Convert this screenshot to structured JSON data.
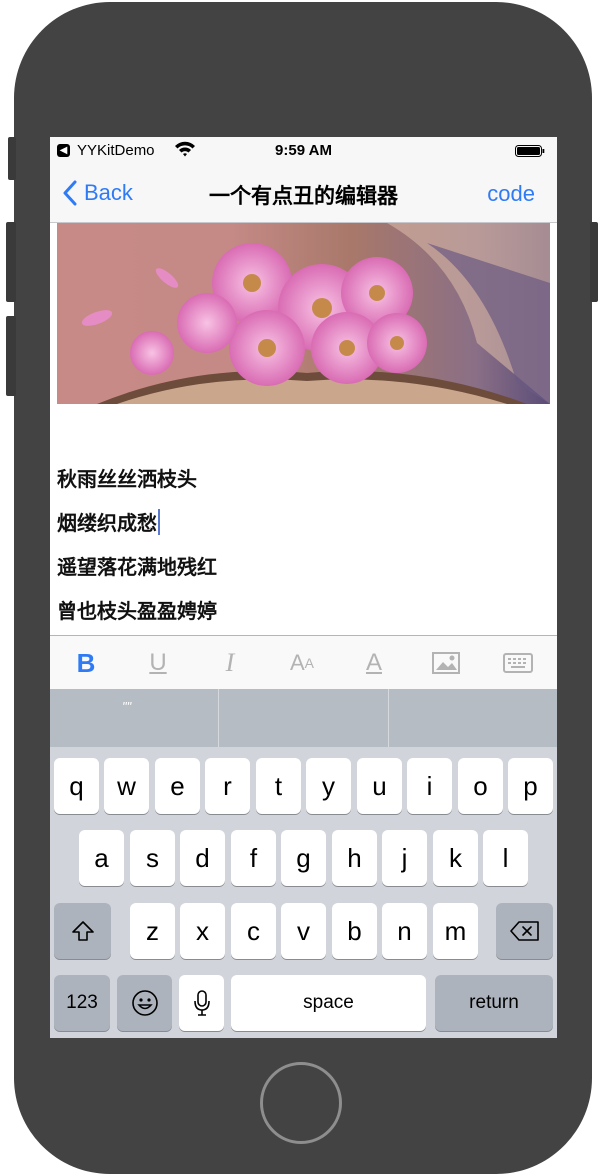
{
  "status_bar": {
    "back_to_app_glyph": "◀",
    "carrier": "YYKitDemo",
    "time": "9:59 AM"
  },
  "nav": {
    "back_label": "Back",
    "title": "一个有点丑的编辑器",
    "code_label": "code",
    "accent_color": "#2f7bf5"
  },
  "editor": {
    "lines": [
      "秋雨丝丝洒枝头",
      "烟缕织成愁",
      "遥望落花满地残红",
      "曾也枝头盈盈娉婷"
    ]
  },
  "toolbar": {
    "bold": "B",
    "underline": "U",
    "italic": "I",
    "font_size_big": "A",
    "font_size_small": "A",
    "text_color": "A",
    "icons": [
      "bold",
      "underline",
      "italic",
      "font-size",
      "text-color",
      "image-icon",
      "keyboard-icon"
    ]
  },
  "keyboard": {
    "suggestion": "\"\"",
    "row1": [
      "q",
      "w",
      "e",
      "r",
      "t",
      "y",
      "u",
      "i",
      "o",
      "p"
    ],
    "row2": [
      "a",
      "s",
      "d",
      "f",
      "g",
      "h",
      "j",
      "k",
      "l"
    ],
    "row3": [
      "z",
      "x",
      "c",
      "v",
      "b",
      "n",
      "m"
    ],
    "numbers_label": "123",
    "space_label": "space",
    "return_label": "return"
  }
}
